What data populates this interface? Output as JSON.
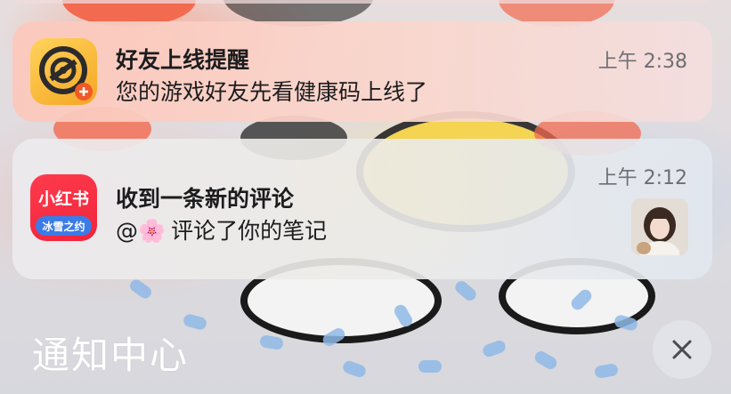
{
  "notifications": [
    {
      "app_icon": "game-app-icon",
      "title": "好友上线提醒",
      "body": "您的游戏好友先看健康码上线了",
      "time": "上午 2:38"
    },
    {
      "app_icon": "xiaohongshu-app-icon",
      "app_icon_text": "小红书",
      "app_icon_subtext": "冰雪之约",
      "title": "收到一条新的评论",
      "body_prefix": "@",
      "body_emoji": "🌸",
      "body": "评论了你的笔记",
      "time": "上午 2:12",
      "thumbnail": "user-avatar-photo"
    }
  ],
  "notification_center": {
    "title": "通知中心",
    "clear_icon": "close-icon"
  },
  "colors": {
    "xiaohongshu_red": "#f0233a",
    "game_icon_yellow": "#f5a623",
    "time_gray": "#6e6e73",
    "wallpaper_drop_blue": "#8fb8e6"
  }
}
